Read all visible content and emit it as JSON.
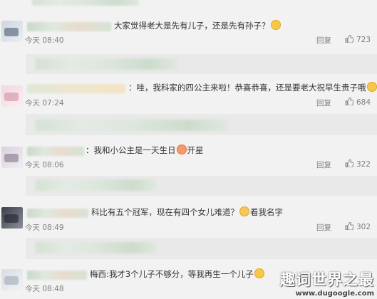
{
  "comments": [
    {
      "text": "大家觉得老大是先有儿子，还是先有孙子？",
      "time": "今天 08:40",
      "reply": "回复",
      "likes": "723"
    },
    {
      "text": "：哇，我科家的四公主来啦！恭喜恭喜，还是要老大祝早生贵子哦",
      "time": "今天 07:24",
      "reply": "回复",
      "likes": "684"
    },
    {
      "text": "：我和小公主是一天生日",
      "text_suffix": "开星",
      "time": "今天 08:06",
      "reply": "回复",
      "likes": "322"
    },
    {
      "text": "科比有五个冠军，现在有四个女儿难道？",
      "text_suffix": "看我名字",
      "time": "今天 08:49",
      "reply": "回复",
      "likes": "302"
    },
    {
      "text": "梅西:我才3个儿子不够分，等我再生一个儿子",
      "time": "今天 08:48",
      "reply": "回复",
      "likes": ""
    }
  ],
  "watermark": {
    "title": "趣词世界之最",
    "url": "www.dugoogle.com"
  },
  "icons": {
    "like": "thumbs-up-icon",
    "emoji": "smiley-emoji-icon"
  }
}
